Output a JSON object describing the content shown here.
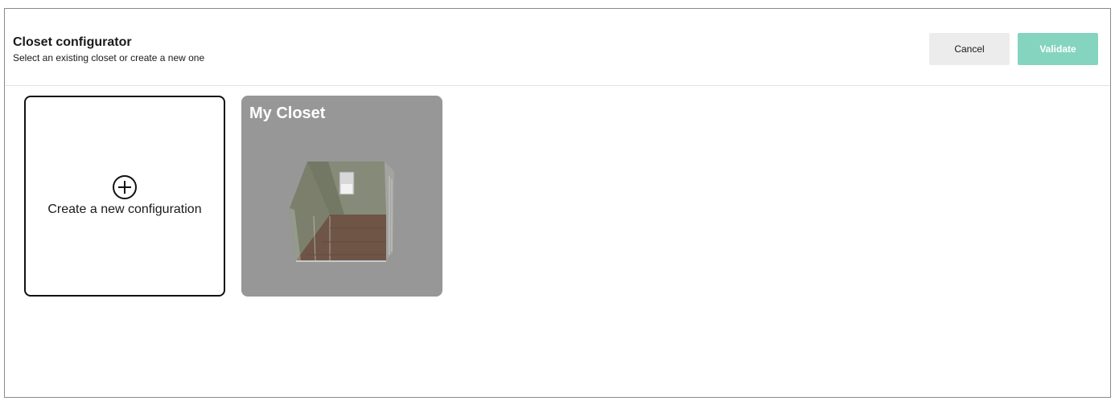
{
  "header": {
    "title": "Closet configurator",
    "subtitle": "Select an existing closet or create a new one"
  },
  "actions": {
    "cancel_label": "Cancel",
    "validate_label": "Validate"
  },
  "colors": {
    "validate_bg": "#84d4bf",
    "cancel_bg": "#ececec",
    "card_bg": "#979797"
  },
  "cards": {
    "new_label": "Create a new configuration",
    "new_icon": "plus-circle-icon",
    "closet_title": "My Closet",
    "closet_thumbnail": "closet-3d-preview"
  }
}
